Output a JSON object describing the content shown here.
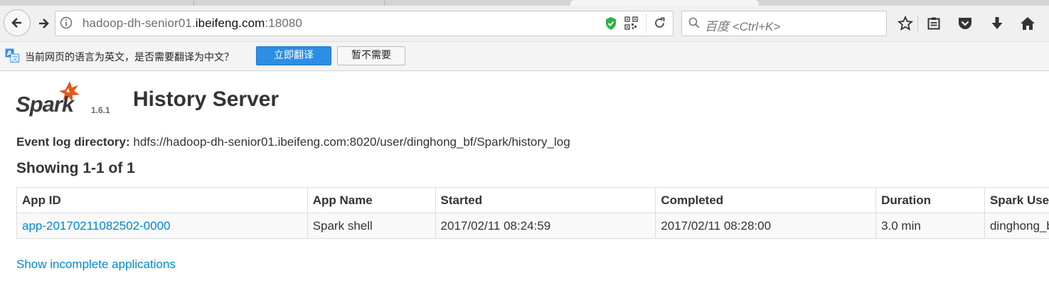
{
  "browser": {
    "url_prefix": "hadoop-dh-senior01.",
    "url_domain": "ibeifeng.com",
    "url_suffix": ":18080",
    "search_placeholder": "百度 <Ctrl+K>"
  },
  "translate_bar": {
    "message": "当前网页的语言为英文，是否需要翻译为中文？",
    "translate_label": "立即翻译",
    "dismiss_label": "暂不需要"
  },
  "page": {
    "logo_text": "Spark",
    "version": "1.6.1",
    "title": "History Server",
    "event_log_label": "Event log directory:",
    "event_log_value": "hdfs://hadoop-dh-senior01.ibeifeng.com:8020/user/dinghong_bf/Spark/history_log",
    "showing": "Showing 1-1 of 1",
    "incomplete_link": "Show incomplete applications"
  },
  "table": {
    "headers": [
      "App ID",
      "App Name",
      "Started",
      "Completed",
      "Duration",
      "Spark User"
    ],
    "rows": [
      [
        "app-20170211082502-0000",
        "Spark shell",
        "2017/02/11 08:24:59",
        "2017/02/11 08:28:00",
        "3.0 min",
        "dinghong_bf"
      ]
    ]
  },
  "colors": {
    "link": "#0088cc",
    "translate_button": "#2d8ee3",
    "spark_star": "#e25a1c"
  }
}
